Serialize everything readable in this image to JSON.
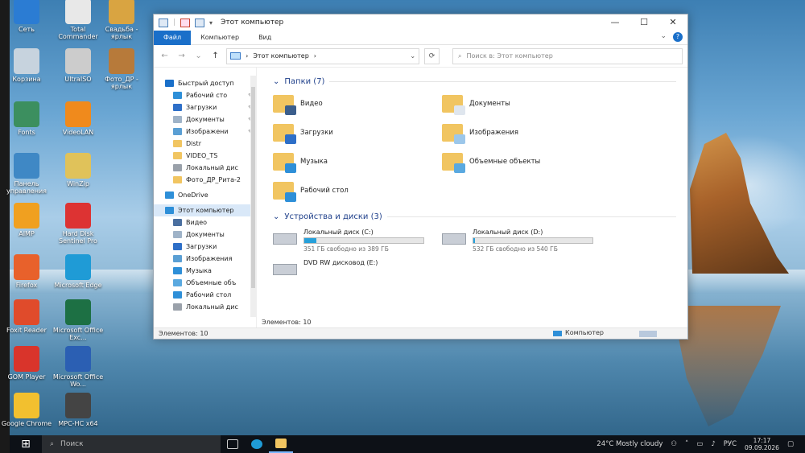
{
  "desktop": {
    "icons": [
      {
        "label": "Сеть",
        "color": "#2b7cd3"
      },
      {
        "label": "Total Commander",
        "color": "#e8e8e8"
      },
      {
        "label": "Свадьба - ярлык",
        "color": "#d9a441"
      },
      {
        "label": "Корзина",
        "color": "#c7d3de"
      },
      {
        "label": "UltraISO",
        "color": "#ccc"
      },
      {
        "label": "Фото_ДР - ярлык",
        "color": "#b77a3a"
      },
      {
        "label": "Fonts",
        "color": "#3c8f5f"
      },
      {
        "label": "VideoLAN",
        "color": "#f08a1c"
      },
      {
        "label": "Панель управления",
        "color": "#3f88c5"
      },
      {
        "label": "WinZip",
        "color": "#e0c25a"
      },
      {
        "label": "AIMP",
        "color": "#f0a020"
      },
      {
        "label": "Hard Disk Sentinel Pro",
        "color": "#d33"
      },
      {
        "label": "Firefox",
        "color": "#e8612b"
      },
      {
        "label": "Microsoft Edge",
        "color": "#1f9bd6"
      },
      {
        "label": "Foxit Reader",
        "color": "#e04b2b"
      },
      {
        "label": "Microsoft Office Exc...",
        "color": "#1d7044"
      },
      {
        "label": "GOM Player",
        "color": "#d9342b"
      },
      {
        "label": "Microsoft Office Wo...",
        "color": "#2b5fb3"
      },
      {
        "label": "Google Chrome",
        "color": "#f2c02f"
      },
      {
        "label": "MPC-HC x64",
        "color": "#444"
      }
    ]
  },
  "window": {
    "title": "Этот компьютер",
    "controls": {
      "minimize": "—",
      "maximize": "☐",
      "close": "✕"
    },
    "ribbon_tabs": [
      "Файл",
      "Компьютер",
      "Вид"
    ],
    "address": {
      "path": "Этот компьютер",
      "separator": "›"
    },
    "search_placeholder": "Поиск в: Этот компьютер",
    "nav": [
      {
        "label": "Быстрый доступ",
        "level": 0,
        "icon": "star-icon",
        "pinned": false,
        "color": "#1a6fc9"
      },
      {
        "label": "Рабочий сто",
        "level": 1,
        "icon": "desktop-icon",
        "pinned": true,
        "color": "#2e8fd8"
      },
      {
        "label": "Загрузки",
        "level": 1,
        "icon": "download-icon",
        "pinned": true,
        "color": "#2e6fc8"
      },
      {
        "label": "Документы",
        "level": 1,
        "icon": "document-icon",
        "pinned": true,
        "color": "#9fb3c8"
      },
      {
        "label": "Изображени",
        "level": 1,
        "icon": "image-icon",
        "pinned": true,
        "color": "#5a9fd4"
      },
      {
        "label": "Distr",
        "level": 1,
        "icon": "folder-icon",
        "pinned": false,
        "color": "#f1c561"
      },
      {
        "label": "VIDEO_TS",
        "level": 1,
        "icon": "folder-icon",
        "pinned": false,
        "color": "#f1c561"
      },
      {
        "label": "Локальный дис",
        "level": 1,
        "icon": "drive-icon",
        "pinned": false,
        "color": "#9aa1aa"
      },
      {
        "label": "Фото_ДР_Рита-2",
        "level": 1,
        "icon": "folder-icon",
        "pinned": false,
        "color": "#f1c561"
      },
      {
        "label": "OneDrive",
        "level": 0,
        "icon": "cloud-icon",
        "pinned": false,
        "color": "#2e8fd8"
      },
      {
        "label": "Этот компьютер",
        "level": 0,
        "icon": "computer-icon",
        "pinned": false,
        "color": "#2e8fd8",
        "selected": true
      },
      {
        "label": "Видео",
        "level": 1,
        "icon": "video-icon",
        "pinned": false,
        "color": "#4a6fa0"
      },
      {
        "label": "Документы",
        "level": 1,
        "icon": "document-icon",
        "pinned": false,
        "color": "#9fb3c8"
      },
      {
        "label": "Загрузки",
        "level": 1,
        "icon": "download-icon",
        "pinned": false,
        "color": "#2e6fc8"
      },
      {
        "label": "Изображения",
        "level": 1,
        "icon": "image-icon",
        "pinned": false,
        "color": "#5a9fd4"
      },
      {
        "label": "Музыка",
        "level": 1,
        "icon": "music-icon",
        "pinned": false,
        "color": "#2e8fd8"
      },
      {
        "label": "Объемные объ",
        "level": 1,
        "icon": "cube-icon",
        "pinned": false,
        "color": "#5aa9e0"
      },
      {
        "label": "Рабочий стол",
        "level": 1,
        "icon": "desktop-icon",
        "pinned": false,
        "color": "#2e8fd8"
      },
      {
        "label": "Локальный дис",
        "level": 1,
        "icon": "drive-icon",
        "pinned": false,
        "color": "#9aa1aa"
      }
    ],
    "folders_header": "Папки (7)",
    "folders": [
      {
        "label": "Видео",
        "badge_color": "#3b5e8c"
      },
      {
        "label": "Документы",
        "badge_color": "#dfe6ee"
      },
      {
        "label": "Загрузки",
        "badge_color": "#2e6fc8"
      },
      {
        "label": "Изображения",
        "badge_color": "#9cc7ea"
      },
      {
        "label": "Музыка",
        "badge_color": "#2e8fd8"
      },
      {
        "label": "Объемные объекты",
        "badge_color": "#5aa9e0"
      },
      {
        "label": "Рабочий стол",
        "badge_color": "#2e8fd8"
      }
    ],
    "drives_header": "Устройства и диски (3)",
    "drives": [
      {
        "label": "Локальный диск (C:)",
        "free": "351 ГБ свободно из 389 ГБ",
        "used_fraction": 0.1
      },
      {
        "label": "Локальный диск (D:)",
        "free": "532 ГБ свободно из 540 ГБ",
        "used_fraction": 0.015
      },
      {
        "label": "DVD RW дисковод (E:)",
        "free": "",
        "used_fraction": null
      }
    ],
    "status_left": "Элементов: 10",
    "status_left_inner": "Элементов: 10",
    "status_right": "Компьютер"
  },
  "taskbar": {
    "search_placeholder": "Поиск",
    "weather": "24°C  Mostly cloudy",
    "lang": "РУС",
    "time": "17:17",
    "date": "09.09.2026"
  }
}
